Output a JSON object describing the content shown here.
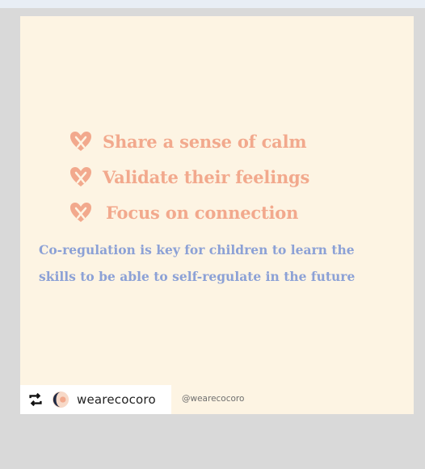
{
  "post": {
    "bullets": [
      {
        "icon": "heart-hug-icon",
        "text": "Share a sense of calm"
      },
      {
        "icon": "heart-hug-icon",
        "text": "Validate their feelings"
      },
      {
        "icon": "heart-hug-icon",
        "text": "Focus on connection"
      }
    ],
    "paragraph": "Co-regulation is key  for children  to learn the skills to be able to self-regulate in the future",
    "colors": {
      "background": "#fdf4e3",
      "accent": "#f2a98d",
      "body_text": "#8ca1d6"
    }
  },
  "attribution": {
    "repost_icon": "repost-icon",
    "username": "wearecocoro",
    "handle": "@wearecocoro"
  }
}
